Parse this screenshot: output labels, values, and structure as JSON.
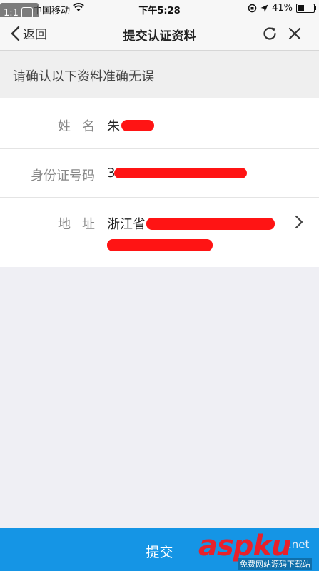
{
  "status_bar": {
    "zoom_badge": "1:1",
    "carrier": "中国移动",
    "time": "下午5:28",
    "battery": "41%",
    "battery_level": 0.41
  },
  "nav": {
    "back_label": "返回",
    "title": "提交认证资料"
  },
  "confirm_header": "请确认以下资料准确无误",
  "fields": {
    "name": {
      "label": "姓名",
      "value": "朱"
    },
    "id_number": {
      "label": "身份证号码",
      "value": "3"
    },
    "address": {
      "label": "地址",
      "value": "浙江省"
    }
  },
  "submit_label": "提交",
  "watermark": {
    "brand": "asp",
    "brand_2": "ku",
    "suffix": ".net",
    "tagline": "免费网站源码下载站"
  },
  "colors": {
    "accent": "#1595e5",
    "redaction": "#ff1414",
    "watermark": "#e8212b"
  }
}
